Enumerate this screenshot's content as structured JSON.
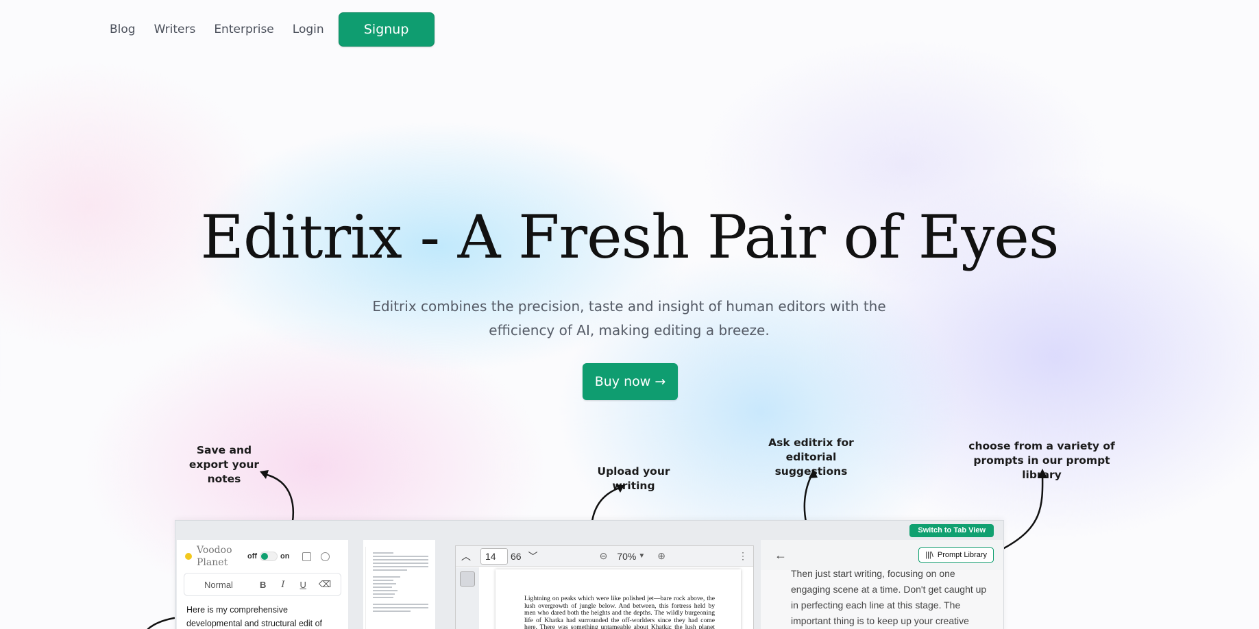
{
  "nav": {
    "links": [
      "Blog",
      "Writers",
      "Enterprise",
      "Login"
    ],
    "signup": "Signup"
  },
  "hero": {
    "title": "Editrix - A Fresh Pair of Eyes",
    "subtitle": "Editrix combines the precision, taste and insight of human editors with the efficiency of AI, making editing a breeze.",
    "cta": "Buy now →"
  },
  "annotations": {
    "save": "Save and export your notes",
    "upload": "Upload your writing",
    "ask": "Ask editrix for editorial suggestions",
    "prompts": "choose from a variety of prompts in our prompt library"
  },
  "app": {
    "switch_tab": "Switch to Tab View",
    "notes": {
      "doc_name": "Voodoo Planet",
      "toggle_off": "off",
      "toggle_on": "on",
      "style_select": "Normal",
      "bold": "B",
      "italic": "I",
      "underline": "U",
      "text": "Here is my comprehensive developmental and structural edit of"
    },
    "viewer": {
      "page": "14",
      "total": "66",
      "zoom": "70%",
      "page_text": "Lightning on peaks which were like polished jet—bare rock above, the lush overgrowth of jungle below. And between, this fortress held by men who dared both the heights and the depths. The wildly burgeoning life of Khatka had surrounded the off-worlders since they had come here. There was something untameable about Khatka; the lush planet lured and yet"
    },
    "chat": {
      "prompt_library": "Prompt Library",
      "text": "Then just start writing, focusing on one engaging scene at a time. Don't get caught up in perfecting each line at this stage. The important thing is to keep up your creative momentum and"
    }
  }
}
